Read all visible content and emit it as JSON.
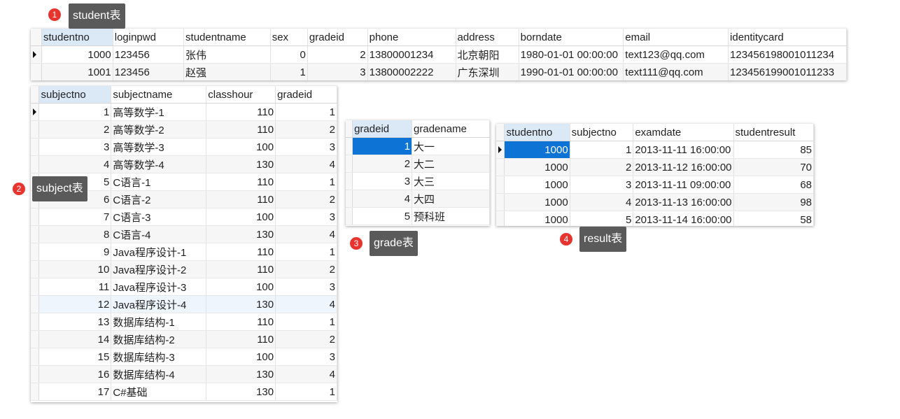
{
  "labels": {
    "student": {
      "num": "1",
      "text": "student表"
    },
    "subject": {
      "num": "2",
      "text": "subject表"
    },
    "grade": {
      "num": "3",
      "text": "grade表"
    },
    "result": {
      "num": "4",
      "text": "result表"
    }
  },
  "student": {
    "columns": [
      "studentno",
      "loginpwd",
      "studentname",
      "sex",
      "gradeid",
      "phone",
      "address",
      "borndate",
      "email",
      "identitycard"
    ],
    "rows": [
      [
        "1000",
        "123456",
        "张伟",
        "0",
        "2",
        "13800001234",
        "北京朝阳",
        "1980-01-01 00:00:00",
        "text123@qq.com",
        "123456198001011234"
      ],
      [
        "1001",
        "123456",
        "赵强",
        "1",
        "3",
        "13800002222",
        "广东深圳",
        "1990-01-01 00:00:00",
        "text111@qq.com",
        "123456199001011233"
      ]
    ]
  },
  "subject": {
    "columns": [
      "subjectno",
      "subjectname",
      "classhour",
      "gradeid"
    ],
    "rows": [
      [
        "1",
        "高等数学-1",
        "110",
        "1"
      ],
      [
        "2",
        "高等数学-2",
        "110",
        "2"
      ],
      [
        "3",
        "高等数学-3",
        "100",
        "3"
      ],
      [
        "4",
        "高等数学-4",
        "130",
        "4"
      ],
      [
        "5",
        "C语言-1",
        "110",
        "1"
      ],
      [
        "6",
        "C语言-2",
        "110",
        "2"
      ],
      [
        "7",
        "C语言-3",
        "100",
        "3"
      ],
      [
        "8",
        "C语言-4",
        "130",
        "4"
      ],
      [
        "9",
        "Java程序设计-1",
        "110",
        "1"
      ],
      [
        "10",
        "Java程序设计-2",
        "110",
        "2"
      ],
      [
        "11",
        "Java程序设计-3",
        "100",
        "3"
      ],
      [
        "12",
        "Java程序设计-4",
        "130",
        "4"
      ],
      [
        "13",
        "数据库结构-1",
        "110",
        "1"
      ],
      [
        "14",
        "数据库结构-2",
        "110",
        "2"
      ],
      [
        "15",
        "数据库结构-3",
        "100",
        "3"
      ],
      [
        "16",
        "数据库结构-4",
        "130",
        "4"
      ],
      [
        "17",
        "C#基础",
        "130",
        "1"
      ]
    ]
  },
  "grade": {
    "columns": [
      "gradeid",
      "gradename"
    ],
    "rows": [
      [
        "1",
        "大一"
      ],
      [
        "2",
        "大二"
      ],
      [
        "3",
        "大三"
      ],
      [
        "4",
        "大四"
      ],
      [
        "5",
        "预科班"
      ]
    ]
  },
  "result": {
    "columns": [
      "studentno",
      "subjectno",
      "examdate",
      "studentresult"
    ],
    "rows": [
      [
        "1000",
        "1",
        "2013-11-11 16:00:00",
        "85"
      ],
      [
        "1000",
        "2",
        "2013-11-12 16:00:00",
        "70"
      ],
      [
        "1000",
        "3",
        "2013-11-11 09:00:00",
        "68"
      ],
      [
        "1000",
        "4",
        "2013-11-13 16:00:00",
        "98"
      ],
      [
        "1000",
        "5",
        "2013-11-14 16:00:00",
        "58"
      ]
    ]
  }
}
